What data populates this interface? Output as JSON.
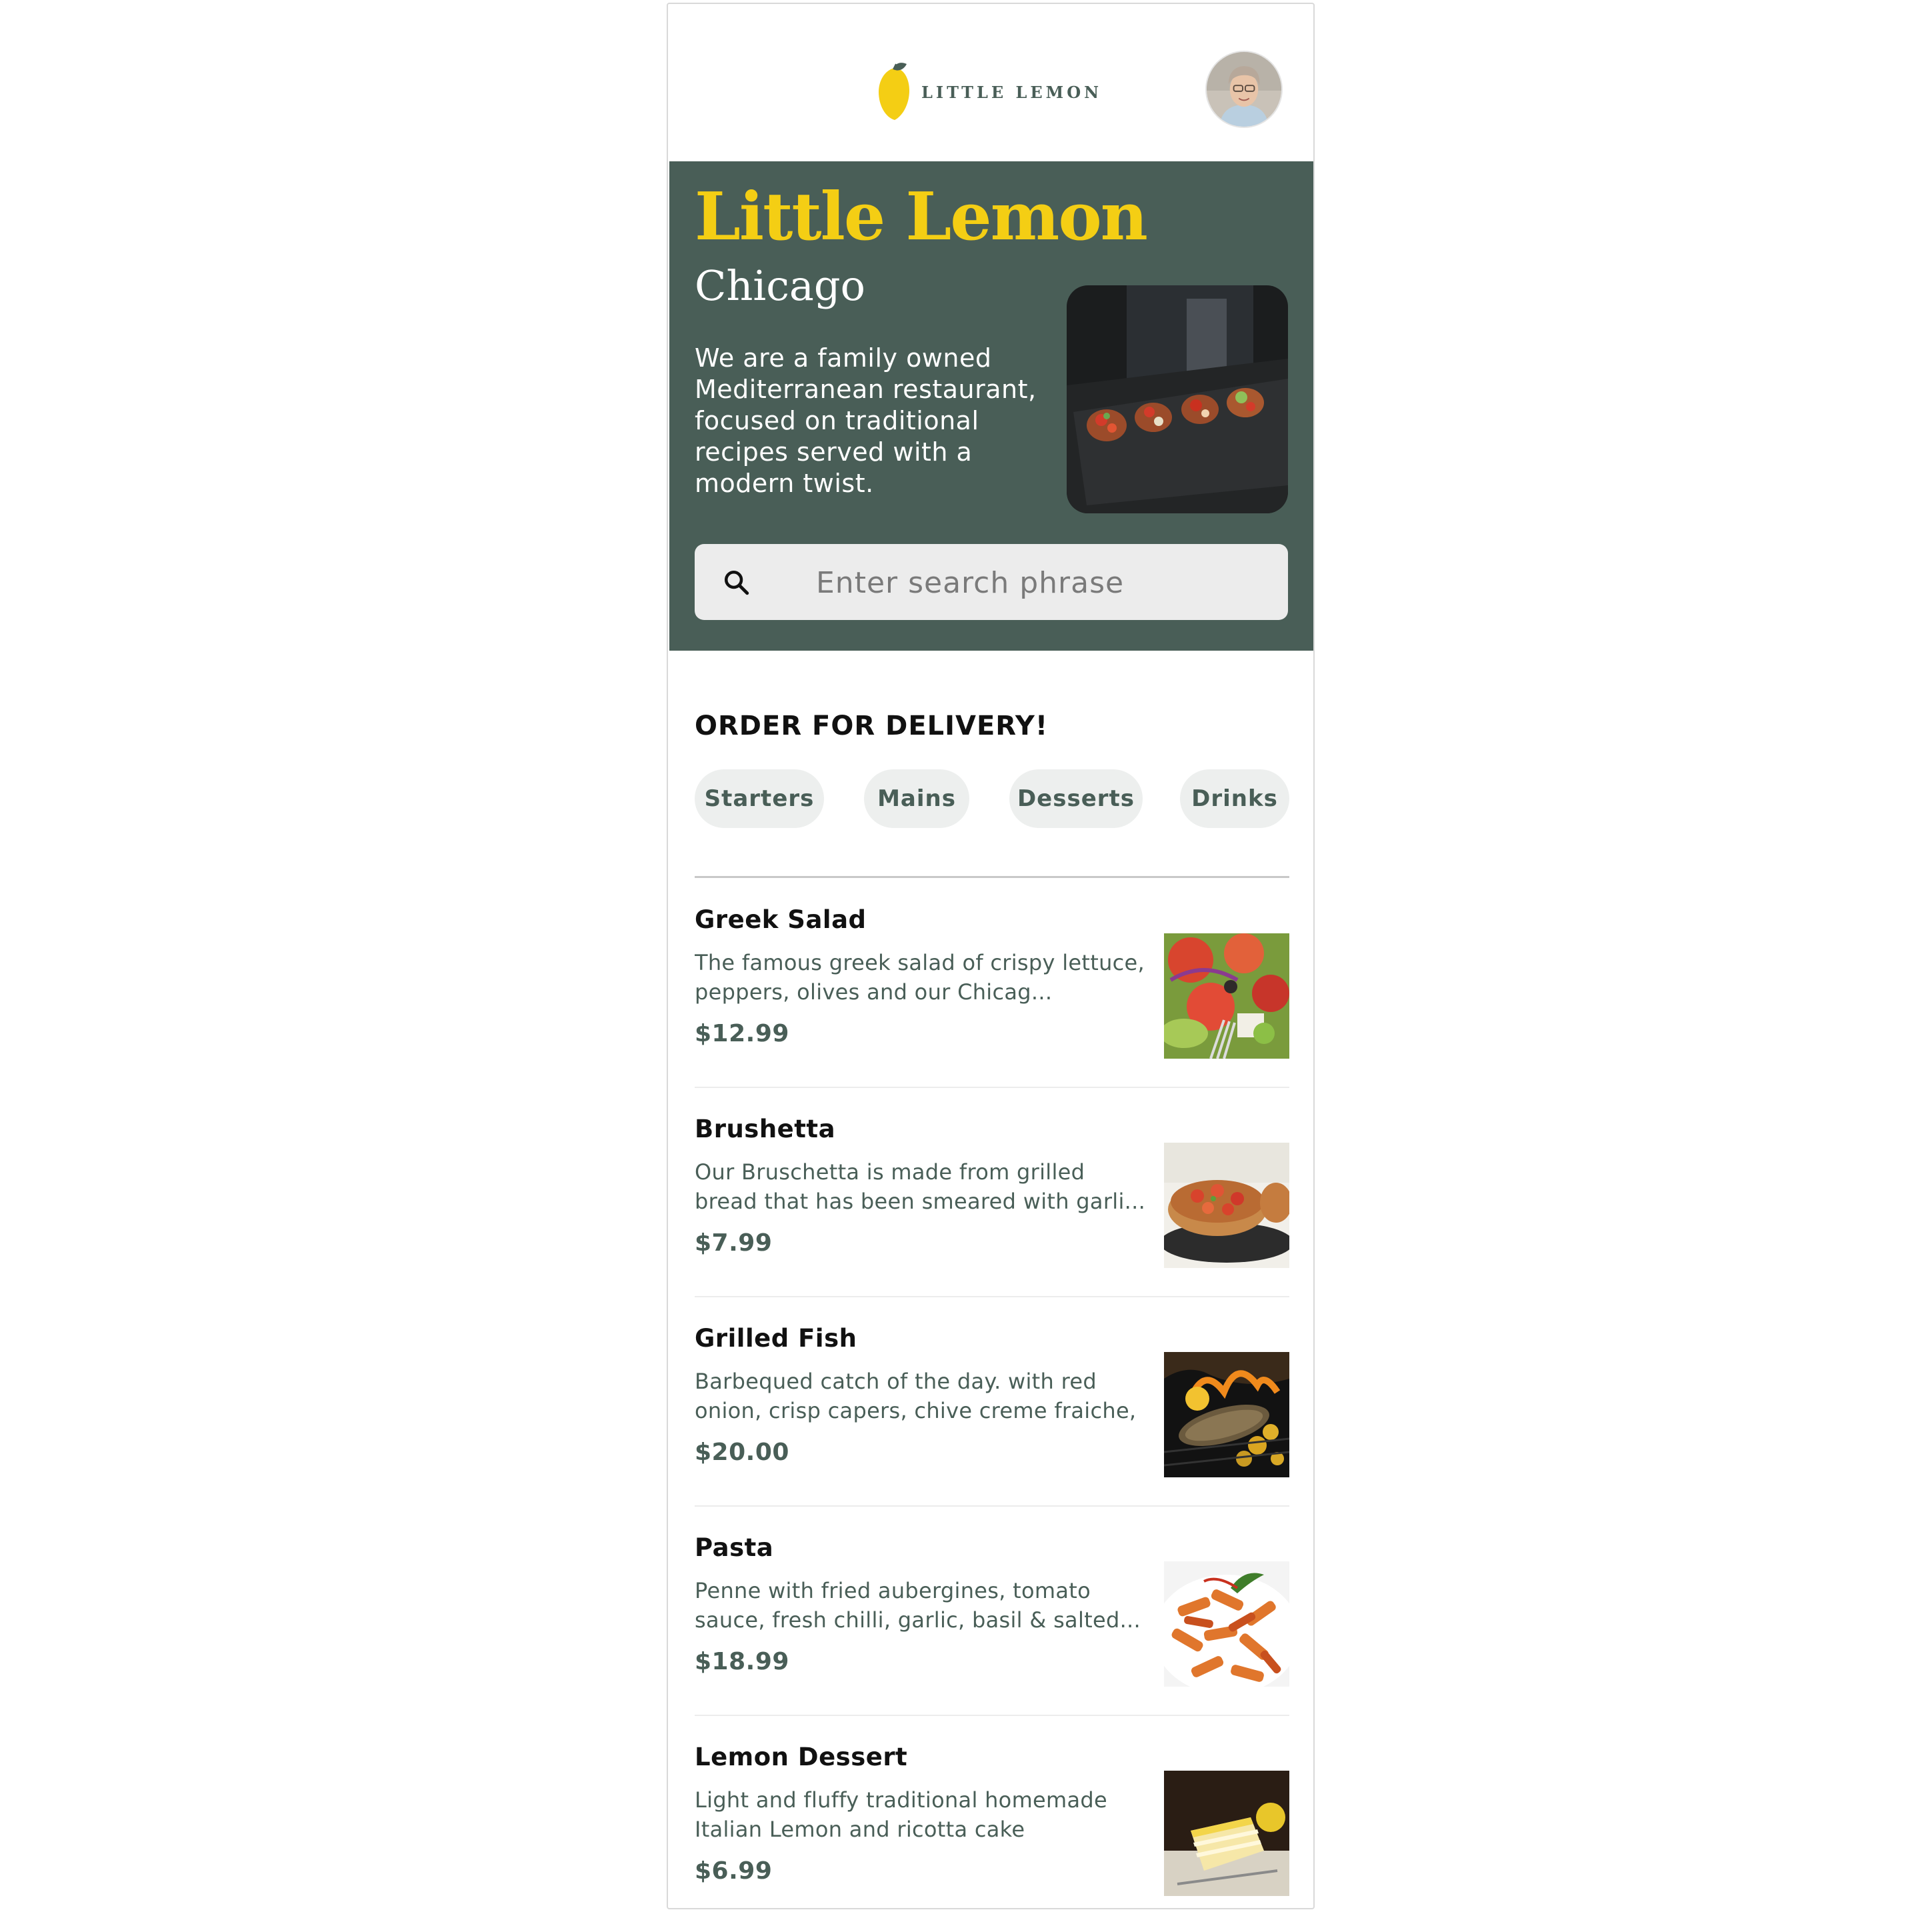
{
  "header": {
    "brand_name": "LITTLE LEMON",
    "logo_icon": "lemon-icon",
    "profile_icon": "user-avatar"
  },
  "hero": {
    "title": "Little Lemon",
    "city": "Chicago",
    "description": "We are a family owned Mediterranean restaurant, focused on traditional recipes served with a modern twist.",
    "image_icon": "bruschetta-platter-image",
    "search": {
      "placeholder": "Enter search phrase",
      "value": "",
      "icon": "search-icon"
    }
  },
  "order": {
    "heading": "ORDER FOR DELIVERY!",
    "categories": [
      {
        "label": "Starters"
      },
      {
        "label": "Mains"
      },
      {
        "label": "Desserts"
      },
      {
        "label": "Drinks"
      }
    ]
  },
  "menu": {
    "items": [
      {
        "name": "Greek Salad",
        "description": "The famous greek salad of crispy lettuce, peppers, olives and our Chicag...",
        "price": "$12.99",
        "image_icon": "greek-salad-image"
      },
      {
        "name": "Brushetta",
        "description": "Our Bruschetta is made from grilled bread that has been smeared with garli...",
        "price": "$7.99",
        "image_icon": "bruschetta-image"
      },
      {
        "name": "Grilled Fish",
        "description": "Barbequed catch of the day. with red onion, crisp capers, chive creme fraiche,",
        "price": "$20.00",
        "image_icon": "grilled-fish-image"
      },
      {
        "name": "Pasta",
        "description": "Penne with fried aubergines,  tomato sauce, fresh chilli, garlic, basil & salted...",
        "price": "$18.99",
        "image_icon": "pasta-image"
      },
      {
        "name": "Lemon Dessert",
        "description": "Light and fluffy traditional homemade Italian Lemon and ricotta cake",
        "price": "$6.99",
        "image_icon": "lemon-cake-image"
      }
    ]
  },
  "colors": {
    "primary_green": "#495e57",
    "accent_yellow": "#f4ce14",
    "chip_background": "#edefee",
    "search_background": "#ececec"
  }
}
